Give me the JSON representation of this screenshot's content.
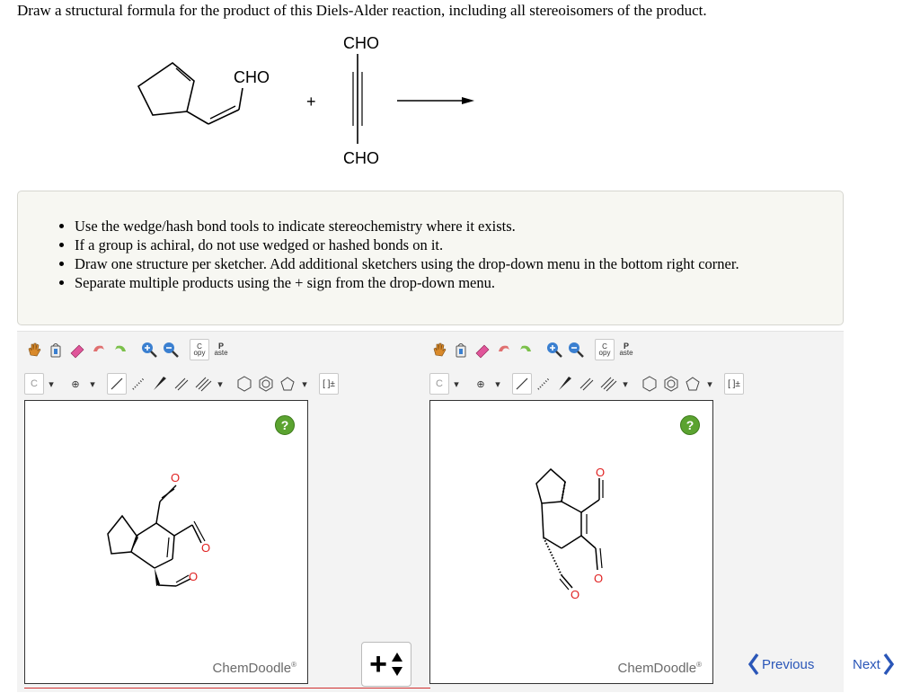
{
  "question": {
    "text": "Draw a structural formula for the product of this Diels-Alder reaction, including all stereoisomers of the product."
  },
  "reaction": {
    "diene_group": "CHO",
    "dienophile_top": "CHO",
    "dienophile_bottom": "CHO",
    "plus": "+"
  },
  "instructions": [
    "Use the wedge/hash bond tools to indicate stereochemistry where it exists.",
    "If a group is achiral, do not use wedged or hashed bonds on it.",
    "Draw one structure per sketcher. Add additional sketchers using the drop-down menu in the bottom right corner.",
    "Separate multiple products using the + sign from the drop-down menu."
  ],
  "sketchers": [
    {
      "toolbar": {
        "copy_label_top": "C",
        "copy_label_bottom": "opy",
        "paste_label_top": "P",
        "paste_label_bottom": "aste",
        "atom_label": "C",
        "bracket_label": "[ ]±"
      },
      "help": "?",
      "brand": "ChemDoodle",
      "brand_mark": "®",
      "atom_labels": [
        "O",
        "O",
        "O"
      ]
    },
    {
      "toolbar": {
        "copy_label_top": "C",
        "copy_label_bottom": "opy",
        "paste_label_top": "P",
        "paste_label_bottom": "aste",
        "atom_label": "C",
        "bracket_label": "[ ]±"
      },
      "help": "?",
      "brand": "ChemDoodle",
      "brand_mark": "®",
      "atom_labels": [
        "O",
        "O",
        "O"
      ]
    }
  ],
  "add_control": {
    "plus": "+",
    "icon": "up-down-arrows-icon"
  },
  "nav": {
    "previous": "Previous",
    "next": "Next"
  },
  "colors": {
    "nav_blue": "#2a56b8",
    "help_green": "#5ba330",
    "oxygen_red": "#e02020",
    "panel_bg": "#f7f7f2"
  }
}
